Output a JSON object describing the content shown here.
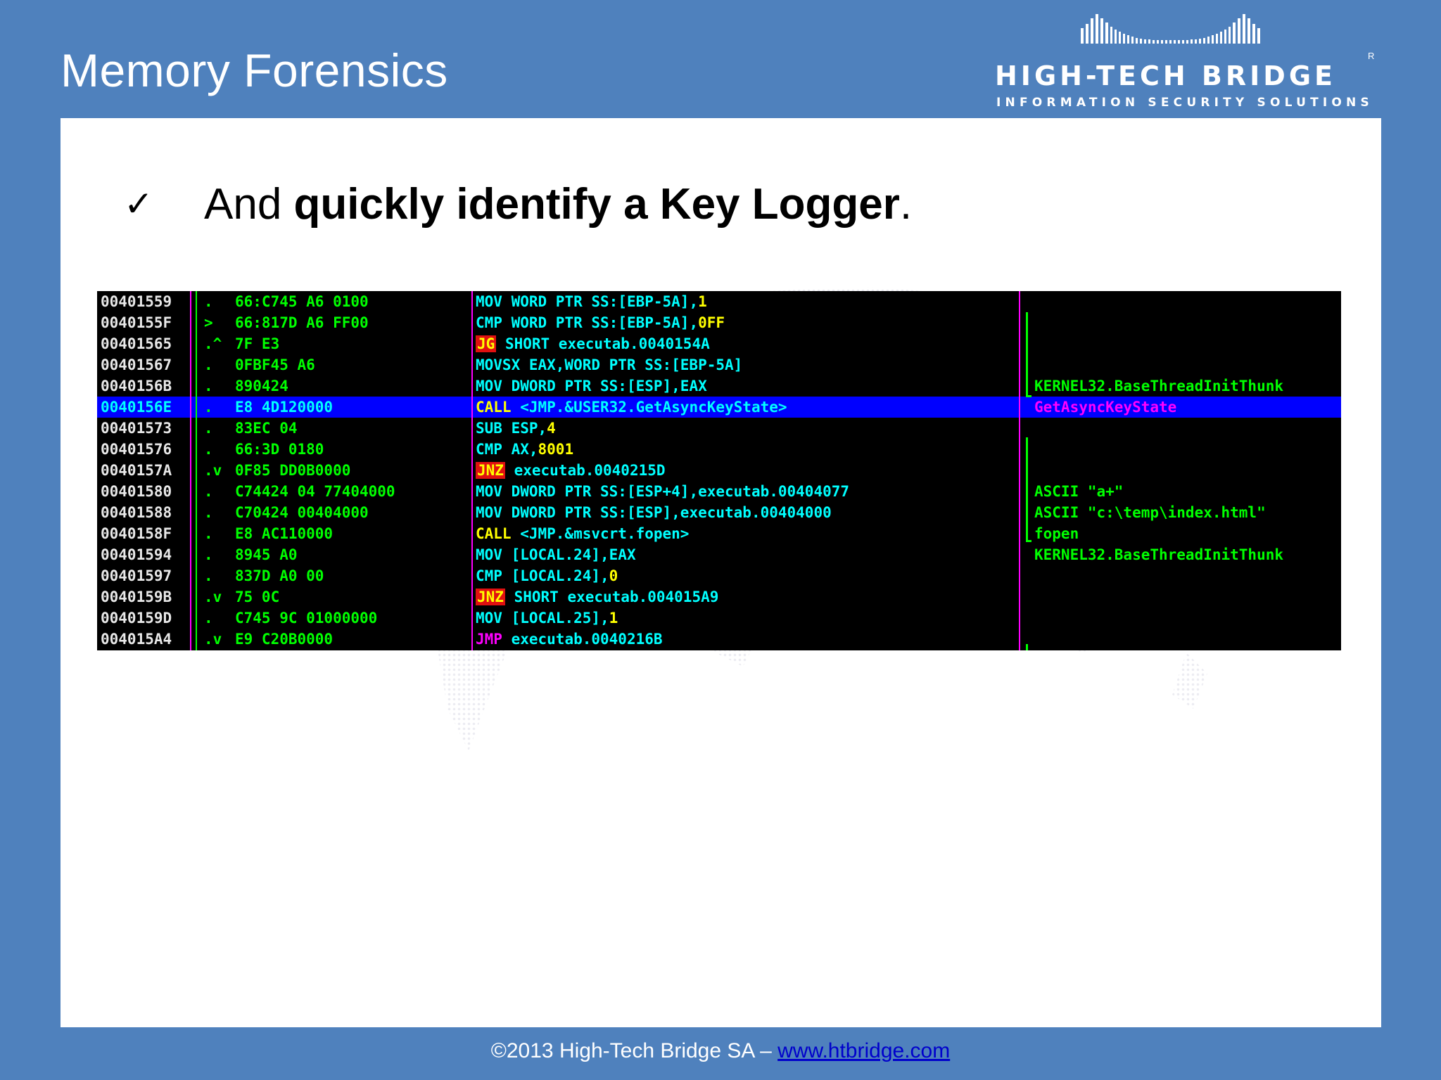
{
  "slide": {
    "title": "Memory Forensics",
    "logo": {
      "brand": "HIGH-TECH BRIDGE",
      "registered": "R",
      "tagline": "INFORMATION SECURITY SOLUTIONS"
    },
    "bullet": {
      "check_icon": "✓",
      "text_prefix": "And ",
      "text_bold": "quickly identify a Key Logger",
      "text_suffix": "."
    },
    "footer": {
      "copyright": "©2013 High-Tech Bridge SA – ",
      "link": "www.htbridge.com"
    }
  },
  "debugger": {
    "selected_row": 5,
    "colors": {
      "background": "#000000",
      "selection": "#0000ff",
      "address": "#e8e8e8",
      "hex": "#00ff00",
      "disasm": "#00ffff",
      "immediate": "#ffff00",
      "jump_highlight": "#e01010",
      "comment_selected": "#ff00ff"
    },
    "rows": [
      {
        "addr": "00401559",
        "mark": ".",
        "hex": "66:C745 A6 0100",
        "op": "MOV",
        "op_style": "",
        "args": "WORD PTR SS:[EBP-5A],",
        "imm": "1",
        "comment": ""
      },
      {
        "addr": "0040155F",
        "mark": ">",
        "hex": "66:817D A6 FF00",
        "op": "CMP",
        "op_style": "",
        "args": "WORD PTR SS:[EBP-5A],",
        "imm": "0FF",
        "comment": ""
      },
      {
        "addr": "00401565",
        "mark": ".^",
        "hex": "7F E3",
        "op": "JG",
        "op_style": "hl",
        "args": "SHORT executab.0040154A",
        "imm": "",
        "comment": ""
      },
      {
        "addr": "00401567",
        "mark": ".",
        "hex": "0FBF45 A6",
        "op": "MOVSX",
        "op_style": "",
        "args": "EAX,WORD PTR SS:[EBP-5A]",
        "imm": "",
        "comment": ""
      },
      {
        "addr": "0040156B",
        "mark": ".",
        "hex": "890424",
        "op": "MOV",
        "op_style": "",
        "args": "DWORD PTR SS:[ESP],EAX",
        "imm": "",
        "comment": "KERNEL32.BaseThreadInitThunk"
      },
      {
        "addr": "0040156E",
        "mark": ".",
        "hex": "E8 4D120000",
        "op": "CALL",
        "op_style": "call",
        "args": "<JMP.&USER32.GetAsyncKeyState>",
        "imm": "",
        "comment": "GetAsyncKeyState"
      },
      {
        "addr": "00401573",
        "mark": ".",
        "hex": "83EC 04",
        "op": "SUB",
        "op_style": "",
        "args": "ESP,",
        "imm": "4",
        "comment": ""
      },
      {
        "addr": "00401576",
        "mark": ".",
        "hex": "66:3D 0180",
        "op": "CMP",
        "op_style": "",
        "args": "AX,",
        "imm": "8001",
        "comment": ""
      },
      {
        "addr": "0040157A",
        "mark": ".v",
        "hex": "0F85 DD0B0000",
        "op": "JNZ",
        "op_style": "hl",
        "args": "executab.0040215D",
        "imm": "",
        "comment": ""
      },
      {
        "addr": "00401580",
        "mark": ".",
        "hex": "C74424 04 77404000",
        "op": "MOV",
        "op_style": "",
        "args": "DWORD PTR SS:[ESP+4],executab.00404077",
        "imm": "",
        "comment": "ASCII \"a+\""
      },
      {
        "addr": "00401588",
        "mark": ".",
        "hex": "C70424 00404000",
        "op": "MOV",
        "op_style": "",
        "args": "DWORD PTR SS:[ESP],executab.00404000",
        "imm": "",
        "comment": "ASCII \"c:\\temp\\index.html\""
      },
      {
        "addr": "0040158F",
        "mark": ".",
        "hex": "E8 AC110000",
        "op": "CALL",
        "op_style": "call",
        "args": "<JMP.&msvcrt.fopen>",
        "imm": "",
        "comment": "fopen"
      },
      {
        "addr": "00401594",
        "mark": ".",
        "hex": "8945 A0",
        "op": "MOV",
        "op_style": "",
        "args": "[LOCAL.24],EAX",
        "imm": "",
        "comment": "KERNEL32.BaseThreadInitThunk"
      },
      {
        "addr": "00401597",
        "mark": ".",
        "hex": "837D A0 00",
        "op": "CMP",
        "op_style": "",
        "args": "[LOCAL.24],",
        "imm": "0",
        "comment": ""
      },
      {
        "addr": "0040159B",
        "mark": ".v",
        "hex": "75 0C",
        "op": "JNZ",
        "op_style": "hl",
        "args": "SHORT executab.004015A9",
        "imm": "",
        "comment": ""
      },
      {
        "addr": "0040159D",
        "mark": ".",
        "hex": "C745 9C 01000000",
        "op": "MOV",
        "op_style": "",
        "args": "[LOCAL.25],",
        "imm": "1",
        "comment": ""
      },
      {
        "addr": "004015A4",
        "mark": ".v",
        "hex": "E9 C20B0000",
        "op": "JMP",
        "op_style": "jmp",
        "args": "executab.0040216B",
        "imm": "",
        "comment": ""
      }
    ]
  }
}
